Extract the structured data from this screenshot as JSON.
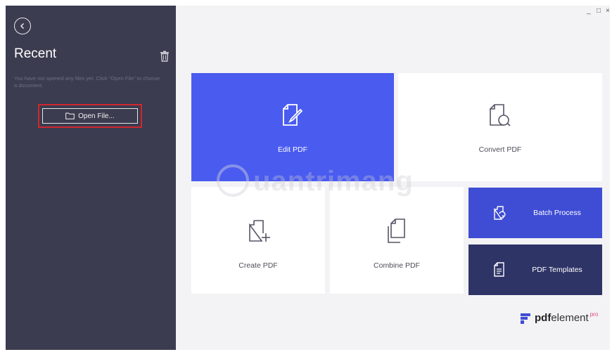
{
  "window": {
    "controls": [
      "_",
      "□",
      "×"
    ]
  },
  "sidebar": {
    "title": "Recent",
    "empty_message": "You have not opened any files yet. Click \"Open File\" to choose a document.",
    "open_button_label": "Open File...",
    "back_icon": "chevron-left-icon",
    "trash_icon": "trash-icon"
  },
  "tiles": {
    "edit": {
      "label": "Edit PDF",
      "icon": "edit-document-icon"
    },
    "convert": {
      "label": "Convert PDF",
      "icon": "convert-document-icon"
    },
    "create": {
      "label": "Create PDF",
      "icon": "create-document-icon"
    },
    "combine": {
      "label": "Combine PDF",
      "icon": "combine-documents-icon"
    },
    "batch": {
      "label": "Batch Process",
      "icon": "batch-process-icon"
    },
    "templates": {
      "label": "PDF Templates",
      "icon": "templates-icon"
    }
  },
  "watermark": "uantrimang",
  "brand": {
    "name_bold": "pdf",
    "name_rest": "element",
    "suffix": "pro"
  },
  "colors": {
    "sidebar": "#3b3c4f",
    "accent_blue": "#4a5bf0",
    "batch_blue": "#3f4dd4",
    "templates_navy": "#2e3466",
    "highlight_red": "#d0262e"
  }
}
